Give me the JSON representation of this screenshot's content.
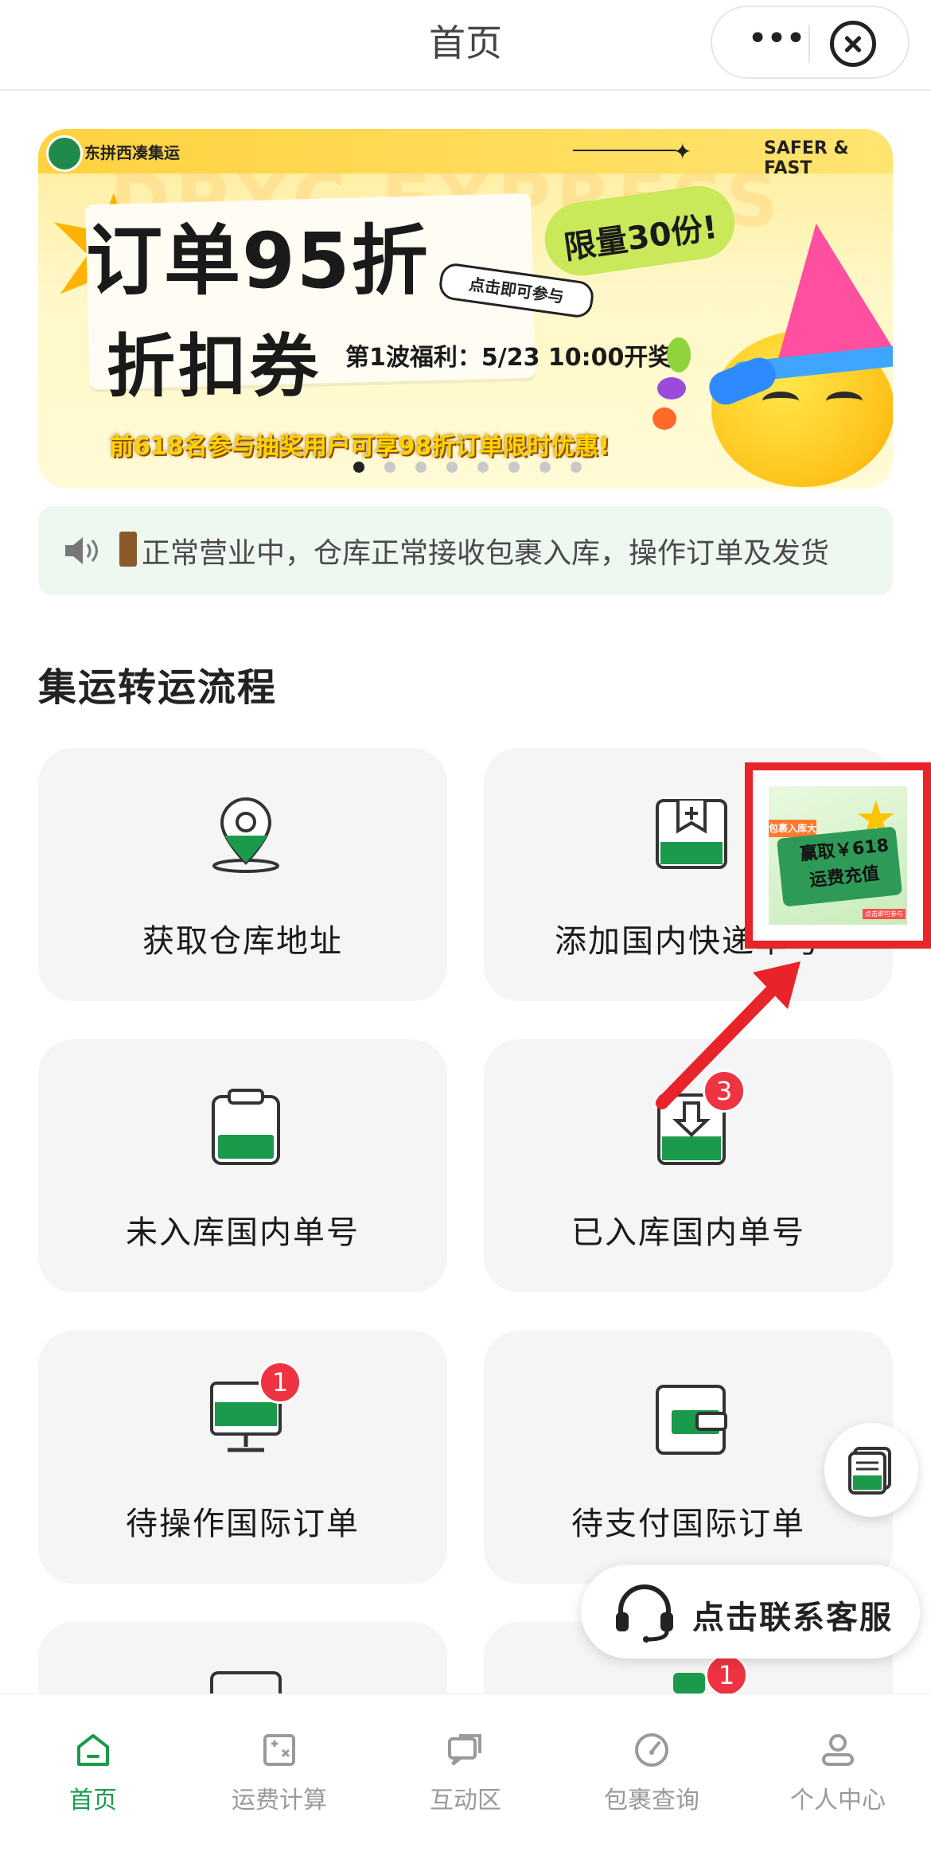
{
  "header": {
    "title": "首页"
  },
  "banner": {
    "brand": "东拼西凑集运",
    "tagline": "SAFER & FAST",
    "watermark": "DPXC EXPRESS",
    "headline1": "订单95折",
    "headline2": "折扣券",
    "limit": "限量30份!",
    "join_tag": "点击即可参与",
    "draw_time": "第1波福利：5/23 10:00开奖!",
    "promo": "前618名参与抽奖用户可享98折订单限时优惠!",
    "slides_total": 8,
    "slide_active": 1
  },
  "notice": {
    "text": "正常营业中，仓库正常接收包裹入库，操作订单及发货"
  },
  "section": {
    "title": "集运转运流程"
  },
  "cards": [
    {
      "label": "获取仓库地址",
      "icon": "location-pin-icon"
    },
    {
      "label": "添加国内快递单号",
      "icon": "add-tracking-icon"
    },
    {
      "label": "未入库国内单号",
      "icon": "clipboard-icon"
    },
    {
      "label": "已入库国内单号",
      "icon": "inbound-icon",
      "badge": "3"
    },
    {
      "label": "待操作国际订单",
      "icon": "monitor-icon",
      "badge": "1"
    },
    {
      "label": "待支付国际订单",
      "icon": "wallet-icon"
    }
  ],
  "partial_card_badge": "1",
  "promo_overlay": {
    "ribbon": "包裹入库大赛",
    "line1": "赢取￥618",
    "line2": "运费充值",
    "small": "点击即可参与"
  },
  "customer_service": {
    "label": "点击联系客服"
  },
  "tabs": [
    {
      "label": "首页",
      "icon": "home-icon",
      "active": true
    },
    {
      "label": "运费计算",
      "icon": "calculator-icon",
      "active": false
    },
    {
      "label": "互动区",
      "icon": "chat-icon",
      "active": false
    },
    {
      "label": "包裹查询",
      "icon": "gauge-icon",
      "active": false
    },
    {
      "label": "个人中心",
      "icon": "person-icon",
      "active": false
    }
  ],
  "colors": {
    "accent": "#1a9a4a",
    "badge": "#ee3342",
    "highlight": "#e8232a"
  }
}
